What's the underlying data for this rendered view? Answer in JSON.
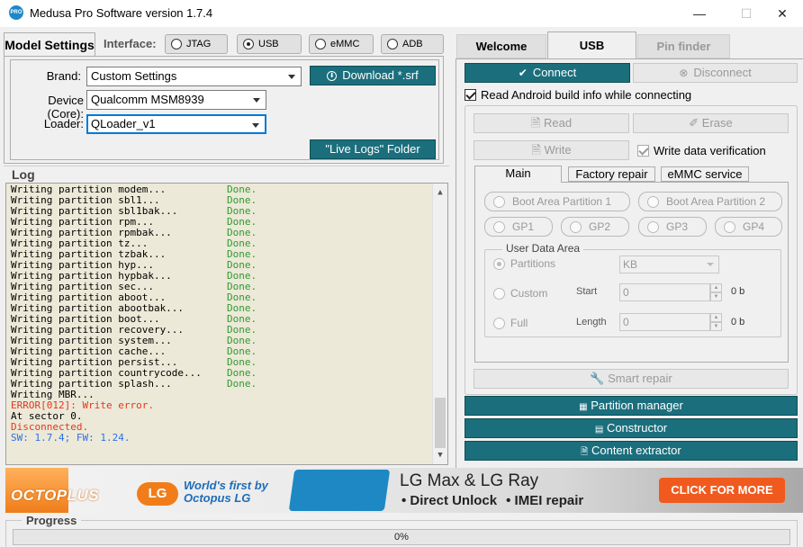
{
  "window": {
    "title": "Medusa Pro Software version 1.7.4",
    "icon_text": "PRO",
    "minimize": "—",
    "maximize": "☐",
    "close": "✕"
  },
  "model_settings": {
    "title": "Model Settings",
    "interface_label": "Interface:",
    "interfaces": [
      {
        "label": "JTAG",
        "selected": false
      },
      {
        "label": "USB",
        "selected": true
      },
      {
        "label": "eMMC",
        "selected": false
      },
      {
        "label": "ADB",
        "selected": false
      }
    ],
    "brand_label": "Brand:",
    "brand_value": "Custom Settings",
    "device_label": "Device (Core):",
    "device_value": "Qualcomm MSM8939",
    "loader_label": "Loader:",
    "loader_value": "QLoader_v1",
    "download_button": "Download *.srf",
    "logs_button": "\"Live Logs\" Folder"
  },
  "log": {
    "title": "Log",
    "lines": [
      {
        "text": "Writing partition modem...",
        "status": "Done."
      },
      {
        "text": "Writing partition sbl1...",
        "status": "Done."
      },
      {
        "text": "Writing partition sbl1bak...",
        "status": "Done."
      },
      {
        "text": "Writing partition rpm...",
        "status": "Done."
      },
      {
        "text": "Writing partition rpmbak...",
        "status": "Done."
      },
      {
        "text": "Writing partition tz...",
        "status": "Done."
      },
      {
        "text": "Writing partition tzbak...",
        "status": "Done."
      },
      {
        "text": "Writing partition hyp...",
        "status": "Done."
      },
      {
        "text": "Writing partition hypbak...",
        "status": "Done."
      },
      {
        "text": "Writing partition sec...",
        "status": "Done."
      },
      {
        "text": "Writing partition aboot...",
        "status": "Done."
      },
      {
        "text": "Writing partition abootbak...",
        "status": "Done."
      },
      {
        "text": "Writing partition boot...",
        "status": "Done."
      },
      {
        "text": "Writing partition recovery...",
        "status": "Done."
      },
      {
        "text": "Writing partition system...",
        "status": "Done."
      },
      {
        "text": "Writing partition cache...",
        "status": "Done."
      },
      {
        "text": "Writing partition persist...",
        "status": "Done."
      },
      {
        "text": "Writing partition countrycode...",
        "status": "Done."
      },
      {
        "text": "Writing partition splash...",
        "status": "Done."
      }
    ],
    "tail": [
      {
        "text": "Writing MBR...",
        "color": "black"
      },
      {
        "text": "ERROR[012]: Write error.",
        "color": "red"
      },
      {
        "text": "At sector 0.",
        "color": "black"
      },
      {
        "text": "Disconnected.",
        "color": "red"
      },
      {
        "text": "SW: 1.7.4; FW: 1.24.",
        "color": "blue"
      }
    ]
  },
  "tabs": [
    {
      "label": "Welcome",
      "active": false
    },
    {
      "label": "USB",
      "active": true
    },
    {
      "label": "Pin finder",
      "active": false
    }
  ],
  "usb": {
    "connect": "Connect",
    "disconnect": "Disconnect",
    "read_android_label": "Read Android build info while connecting",
    "read_android_checked": true,
    "read": "Read",
    "erase": "Erase",
    "write": "Write",
    "write_verify_label": "Write data verification",
    "write_verify_checked": true,
    "subtabs": [
      "Main",
      "Factory repair",
      "eMMC service"
    ],
    "boot1": "Boot Area Partition 1",
    "boot2": "Boot Area Partition 2",
    "gp": [
      "GP1",
      "GP2",
      "GP3",
      "GP4"
    ],
    "user_data_area": "User Data Area",
    "partitions": "Partitions",
    "unit_value": "KB",
    "custom": "Custom",
    "full": "Full",
    "start_label": "Start",
    "length_label": "Length",
    "start_value": "0",
    "length_value": "0",
    "start_unit": "0 b",
    "length_unit": "0 b",
    "smart_repair": "Smart repair",
    "partition_manager": "Partition manager",
    "constructor": "Constructor",
    "content_extractor": "Content extractor"
  },
  "banner": {
    "brand": "OCTOPLUS",
    "lg": "LG",
    "slogan1": "World's first by",
    "slogan2": "Octopus LG",
    "headline": "LG Max & LG Ray",
    "feature1": "• Direct Unlock",
    "feature2": "• IMEI repair",
    "cta": "CLICK FOR MORE"
  },
  "progress": {
    "title": "Progress",
    "text": "0%",
    "value": 0
  }
}
